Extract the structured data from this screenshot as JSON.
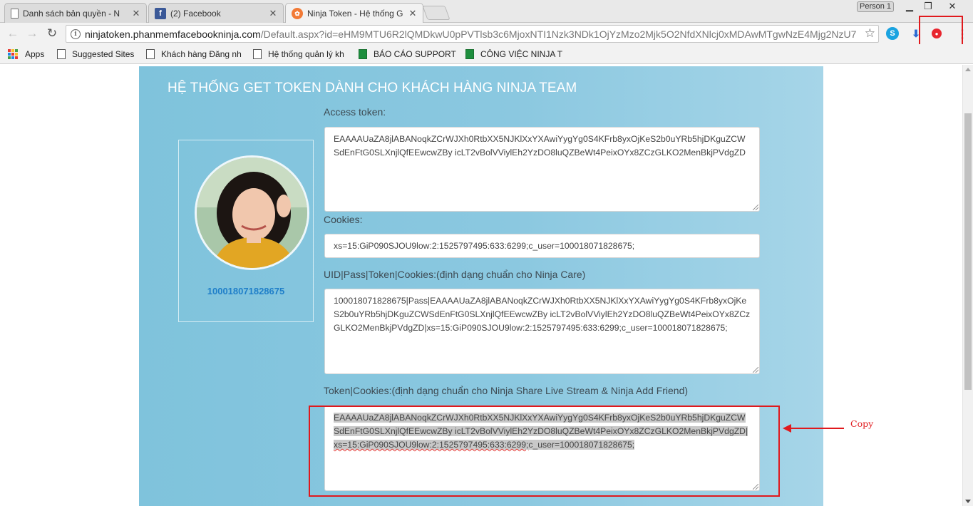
{
  "browser": {
    "tabs": [
      {
        "title": "Danh sách bản quyền - N",
        "icon": "page-icon"
      },
      {
        "title": "(2) Facebook",
        "icon": "facebook-icon"
      },
      {
        "title": "Ninja Token - Hệ thống G",
        "icon": "ninja-icon",
        "active": true
      }
    ],
    "profile_name": "Person 1",
    "url_host": "ninjatoken.phanmemfacebookninja.com",
    "url_path": "/Default.aspx?id=eHM9MTU6R2lQMDkwU0pPVTlsb3c6MjoxNTI1Nzk3NDk1OjYzMzo2Mjk5O2NfdXNlcj0xMDAwMTgwNzE4Mjg2NzU7",
    "bookmarks": [
      {
        "label": "Apps",
        "icon": "apps-grid-icon"
      },
      {
        "label": "Suggested Sites",
        "icon": "page-icon"
      },
      {
        "label": "Khách hàng Đăng nh",
        "icon": "page-icon"
      },
      {
        "label": "Hệ thống quản lý kh",
        "icon": "page-icon"
      },
      {
        "label": "BÁO CÁO SUPPORT",
        "icon": "sheets-icon"
      },
      {
        "label": "CÔNG VIỆC NINJA T",
        "icon": "sheets-icon"
      }
    ]
  },
  "page": {
    "title": "HỆ THỐNG GET TOKEN DÀNH CHO KHÁCH HÀNG NINJA TEAM",
    "profile": {
      "uid": "100018071828675"
    },
    "fields": {
      "access_token": {
        "label": "Access token:",
        "value": "EAAAAUaZA8jlABANoqkZCrWJXh0RtbXX5NJKlXxYXAwiYygYg0S4KFrb8yxOjKeS2b0uYRb5hjDKguZCWSdEnFtG0SLXnjlQfEEwcwZBy icLT2vBolVViylEh2YzDO8luQZBeWt4PeixOYx8ZCzGLKO2MenBkjPVdgZD"
      },
      "cookies": {
        "label": "Cookies:",
        "value": "xs=15:GiP090SJOU9low:2:1525797495:633:6299;c_user=100018071828675;"
      },
      "uid_pass_token_cookies": {
        "label": "UID|Pass|Token|Cookies:(định dạng chuẩn cho Ninja Care)",
        "value": "100018071828675|Pass|EAAAAUaZA8jlABANoqkZCrWJXh0RtbXX5NJKlXxYXAwiYygYg0S4KFrb8yxOjKeS2b0uYRb5hjDKguZCWSdEnFtG0SLXnjlQfEEwcwZBy icLT2vBolVViylEh2YzDO8luQZBeWt4PeixOYx8ZCzGLKO2MenBkjPVdgZD|xs=15:GiP090SJOU9low:2:1525797495:633:6299;c_user=100018071828675;"
      },
      "token_cookies": {
        "label": "Token|Cookies:(định dạng chuẩn cho Ninja Share Live Stream & Ninja Add Friend)",
        "value_token": "EAAAAUaZA8jlABANoqkZCrWJXh0RtbXX5NJKlXxYXAwiYygYg0S4KFrb8yxOjKeS2b0uYRb5hjDKguZCWSdEnFtG0SLXnjlQfEEwcwZBy icLT2vBolVViylEh2YzDO8luQZBeWt4PeixOYx8ZCzGLKO2MenBkjPVdgZD|",
        "value_cookies": "xs=15:GiP090SJOU9low:2:1525797495:633:6299;",
        "value_tail": "c_user=100018071828675;"
      }
    }
  },
  "annotation": {
    "copy_label": "Copy",
    "color": "#e0191d"
  },
  "colors": {
    "panel": "#8bc8e0",
    "uid_link": "#1f7fc9"
  }
}
